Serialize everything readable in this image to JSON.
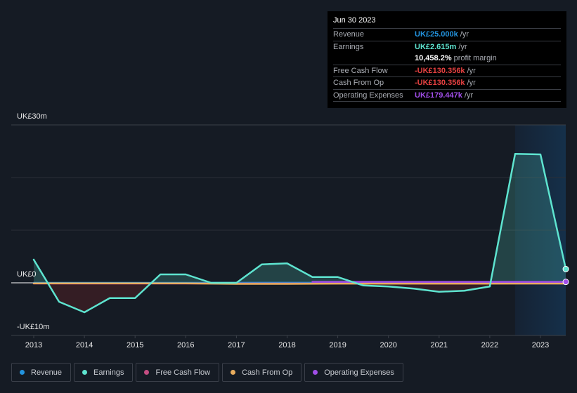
{
  "tooltip": {
    "date": "Jun 30 2023",
    "rows": [
      {
        "label": "Revenue",
        "value": "UK£25.000k",
        "unit": "/yr",
        "color": "#2394df"
      },
      {
        "label": "Earnings",
        "value": "UK£2.615m",
        "unit": "/yr",
        "color": "#5ee4d0"
      },
      {
        "label": "",
        "value": "10,458.2%",
        "unit": "profit margin",
        "color": "#ffffff"
      },
      {
        "label": "Free Cash Flow",
        "value": "-UK£130.356k",
        "unit": "/yr",
        "color": "#e64141"
      },
      {
        "label": "Cash From Op",
        "value": "-UK£130.356k",
        "unit": "/yr",
        "color": "#e64141"
      },
      {
        "label": "Operating Expenses",
        "value": "UK£179.447k",
        "unit": "/yr",
        "color": "#a14ee8"
      }
    ]
  },
  "legend": [
    {
      "label": "Revenue",
      "color": "#2394df"
    },
    {
      "label": "Earnings",
      "color": "#5ee4d0"
    },
    {
      "label": "Free Cash Flow",
      "color": "#c44d82"
    },
    {
      "label": "Cash From Op",
      "color": "#e8ad5e"
    },
    {
      "label": "Operating Expenses",
      "color": "#a14ee8"
    }
  ],
  "chart_data": {
    "type": "area",
    "title": "",
    "xlabel": "",
    "ylabel": "",
    "y_tick_labels": [
      "UK£30m",
      "UK£0",
      "-UK£10m"
    ],
    "ylim": [
      -10,
      30
    ],
    "y_unit": "UK£m",
    "xlim": [
      2012.55,
      2023.5
    ],
    "x_ticks": [
      2013,
      2014,
      2015,
      2016,
      2017,
      2018,
      2019,
      2020,
      2021,
      2022,
      2023
    ],
    "x_tick_labels": [
      "2013",
      "2014",
      "2015",
      "2016",
      "2017",
      "2018",
      "2019",
      "2020",
      "2021",
      "2022",
      "2023"
    ],
    "grid": true,
    "highlight_range": [
      2022.5,
      2023.5
    ],
    "legend_position": "bottom",
    "series": [
      {
        "name": "Revenue",
        "color": "#2394df",
        "x": [
          2013.0,
          2023.5
        ],
        "values": [
          0.0,
          0.025
        ]
      },
      {
        "name": "Earnings",
        "color": "#5ee4d0",
        "x": [
          2013.0,
          2013.5,
          2014.0,
          2014.5,
          2015.0,
          2015.5,
          2016.0,
          2016.5,
          2017.0,
          2017.5,
          2018.0,
          2018.5,
          2019.0,
          2019.5,
          2020.0,
          2020.5,
          2021.0,
          2021.5,
          2022.0,
          2022.5,
          2023.0,
          2023.5
        ],
        "values": [
          4.4,
          -3.6,
          -5.6,
          -2.9,
          -2.9,
          1.6,
          1.6,
          0.0,
          0.0,
          3.5,
          3.7,
          1.1,
          1.1,
          -0.5,
          -0.7,
          -1.1,
          -1.7,
          -1.5,
          -0.7,
          24.5,
          24.4,
          2.615
        ]
      },
      {
        "name": "Free Cash Flow",
        "color": "#c44d82",
        "x": [
          2013.0,
          2023.5
        ],
        "values": [
          -0.13,
          -0.13
        ]
      },
      {
        "name": "Cash From Op",
        "color": "#e8ad5e",
        "x": [
          2013.0,
          2016.0,
          2017.0,
          2018.0,
          2019.0,
          2020.0,
          2021.0,
          2022.0,
          2023.0,
          2023.5
        ],
        "values": [
          -0.1,
          -0.1,
          -0.2,
          -0.2,
          -0.15,
          -0.15,
          -0.15,
          -0.15,
          -0.13,
          -0.13
        ]
      },
      {
        "name": "Operating Expenses",
        "color": "#a14ee8",
        "x": [
          2018.5,
          2019.0,
          2020.0,
          2021.0,
          2022.0,
          2023.0,
          2023.5
        ],
        "values": [
          0.18,
          0.18,
          0.18,
          0.18,
          0.18,
          0.18,
          0.179
        ]
      }
    ]
  }
}
